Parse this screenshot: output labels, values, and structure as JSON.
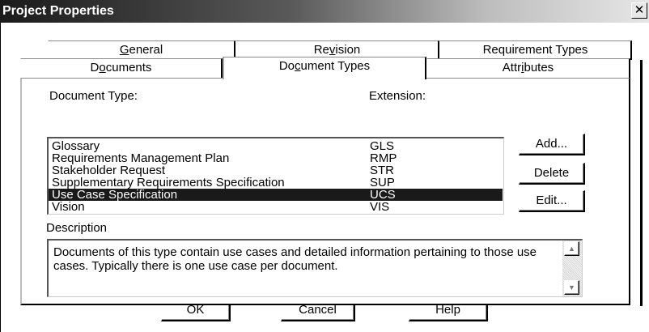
{
  "window": {
    "title": "Project Properties",
    "close_glyph": "✕"
  },
  "tabs_back": [
    {
      "label": "General",
      "mnemonic_index": 0
    },
    {
      "label": "Revision",
      "mnemonic_index": 2
    },
    {
      "label": "Requirement Types"
    }
  ],
  "tabs_front": [
    {
      "label": "Documents",
      "mnemonic_index": 1
    },
    {
      "label": "Document Types",
      "mnemonic_index": 2,
      "active": true
    },
    {
      "label": "Attributes",
      "mnemonic_index": 4
    }
  ],
  "list": {
    "header_type": "Document Type:",
    "header_ext": "Extension:",
    "selected_index": 4,
    "rows": [
      {
        "name": "Glossary",
        "ext": "GLS"
      },
      {
        "name": "Requirements Management Plan",
        "ext": "RMP"
      },
      {
        "name": "Stakeholder Request",
        "ext": "STR"
      },
      {
        "name": "Supplementary Requirements Specification",
        "ext": "SUP"
      },
      {
        "name": "Use Case Specification",
        "ext": "UCS"
      },
      {
        "name": "Vision",
        "ext": "VIS"
      }
    ]
  },
  "side_buttons": {
    "add": "Add...",
    "delete": "Delete",
    "edit": "Edit..."
  },
  "description": {
    "label": "Description",
    "text": "Documents of this type contain use cases and detailed information pertaining to those use cases.  Typically there is one use case per document."
  },
  "footer_buttons": {
    "ok": "OK",
    "cancel": "Cancel",
    "help": "Help"
  },
  "colors": {
    "selection": "#1a1a1a",
    "titlebar_dark": "#1a1a1a"
  }
}
